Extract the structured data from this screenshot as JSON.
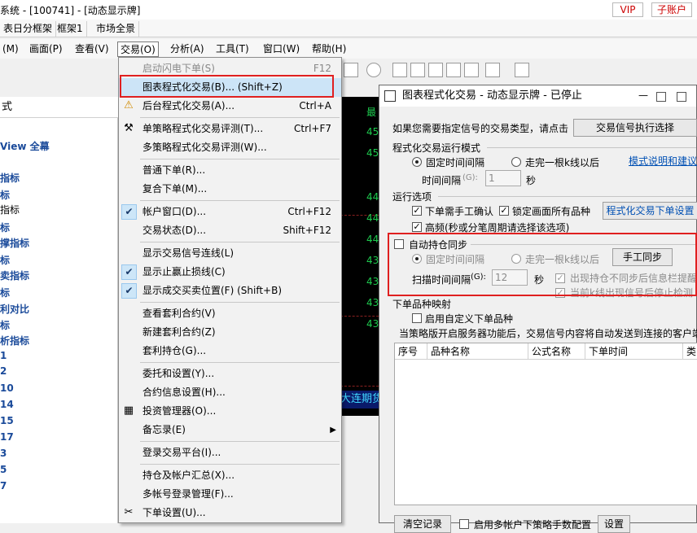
{
  "titlebar": {
    "title": "系统 - [100741] - [动态显示牌]",
    "vip": "VIP",
    "sub_account": "子账户"
  },
  "tabs": [
    "表日分框架",
    "框架1",
    "市场全景"
  ],
  "menubar": [
    "(M)",
    "画面(P)",
    "查看(V)",
    "交易(O)",
    "分析(A)",
    "工具(T)",
    "窗口(W)",
    "帮助(H)"
  ],
  "left_panel": {
    "header": "式",
    "items": [
      {
        "label": "View 全幕",
        "style": "bold"
      },
      {
        "label": "指标",
        "style": "bold"
      },
      {
        "label": "标",
        "style": "bold"
      },
      {
        "label": "指标",
        "style": "plain"
      },
      {
        "label": "标",
        "style": "bold"
      },
      {
        "label": "撑指标",
        "style": "bold"
      },
      {
        "label": "标",
        "style": "bold"
      },
      {
        "label": "卖指标",
        "style": "bold"
      },
      {
        "label": "标",
        "style": "bold"
      },
      {
        "label": "利对比",
        "style": "bold"
      },
      {
        "label": "标",
        "style": "bold"
      },
      {
        "label": "析指标",
        "style": "bold"
      },
      {
        "label": "1",
        "style": "bold"
      },
      {
        "label": "2",
        "style": "bold"
      },
      {
        "label": "10",
        "style": "bold"
      },
      {
        "label": "14",
        "style": "bold"
      },
      {
        "label": "15",
        "style": "bold"
      },
      {
        "label": "17",
        "style": "bold"
      },
      {
        "label": "3",
        "style": "bold"
      },
      {
        "label": "5",
        "style": "bold"
      },
      {
        "label": "7",
        "style": "bold"
      }
    ]
  },
  "chart": {
    "top_label": "最",
    "prices": [
      "45",
      "45",
      "44",
      "44",
      "44",
      "43",
      "43",
      "43",
      "43"
    ],
    "footer": "大连期货"
  },
  "trade_menu": {
    "items": [
      {
        "label": "启动闪电下单(S)",
        "shortcut": "F12",
        "state": "disabled",
        "icon": ""
      },
      {
        "label": "图表程式化交易(B)...  (Shift+Z)",
        "shortcut": "",
        "state": "highlight",
        "icon": ""
      },
      {
        "label": "后台程式化交易(A)...",
        "shortcut": "Ctrl+A",
        "state": "normal",
        "icon": "warning"
      },
      {
        "sep": true
      },
      {
        "label": "单策略程式化交易评测(T)...",
        "shortcut": "Ctrl+F7",
        "state": "normal",
        "icon": "hammer"
      },
      {
        "label": "多策略程式化交易评测(W)...",
        "shortcut": "",
        "state": "normal",
        "icon": ""
      },
      {
        "sep": true
      },
      {
        "label": "普通下单(R)...",
        "shortcut": "",
        "state": "normal",
        "icon": ""
      },
      {
        "label": "复合下单(M)...",
        "shortcut": "",
        "state": "normal",
        "icon": ""
      },
      {
        "sep": true
      },
      {
        "label": "帐户窗口(D)...",
        "shortcut": "Ctrl+F12",
        "state": "checked",
        "icon": ""
      },
      {
        "label": "交易状态(D)...",
        "shortcut": "Shift+F12",
        "state": "normal",
        "icon": ""
      },
      {
        "sep": true
      },
      {
        "label": "显示交易信号连线(L)",
        "shortcut": "",
        "state": "normal",
        "icon": ""
      },
      {
        "label": "显示止赢止损线(C)",
        "shortcut": "",
        "state": "checked",
        "icon": ""
      },
      {
        "label": "显示成交买卖位置(F)  (Shift+B)",
        "shortcut": "",
        "state": "checked",
        "icon": ""
      },
      {
        "sep": true
      },
      {
        "label": "查看套利合约(V)",
        "shortcut": "",
        "state": "normal",
        "icon": ""
      },
      {
        "label": "新建套利合约(Z)",
        "shortcut": "",
        "state": "normal",
        "icon": ""
      },
      {
        "label": "套利持仓(G)...",
        "shortcut": "",
        "state": "normal",
        "icon": ""
      },
      {
        "sep": true
      },
      {
        "label": "委托和设置(Y)...",
        "shortcut": "",
        "state": "normal",
        "icon": ""
      },
      {
        "label": "合约信息设置(H)...",
        "shortcut": "",
        "state": "normal",
        "icon": ""
      },
      {
        "label": "投资管理器(O)...",
        "shortcut": "",
        "state": "normal",
        "icon": "grid"
      },
      {
        "label": "备忘录(E)",
        "shortcut": "",
        "state": "submenu",
        "icon": ""
      },
      {
        "sep": true
      },
      {
        "label": "登录交易平台(I)...",
        "shortcut": "",
        "state": "normal",
        "icon": ""
      },
      {
        "sep": true
      },
      {
        "label": "持仓及帐户汇总(X)...",
        "shortcut": "",
        "state": "normal",
        "icon": ""
      },
      {
        "label": "多帐号登录管理(F)...",
        "shortcut": "",
        "state": "normal",
        "icon": ""
      },
      {
        "label": "下单设置(U)...",
        "shortcut": "",
        "state": "normal",
        "icon": "tools"
      }
    ]
  },
  "dialog": {
    "title": "图表程式化交易 - 动态显示牌 - 已停止",
    "intro": "如果您需要指定信号的交易类型，请点击",
    "signal_btn": "交易信号执行选择",
    "mode_group": "程式化交易运行模式",
    "radio_fixed": "固定时间间隔",
    "radio_bar": "走完一根k线以后",
    "mode_link": "模式说明和建议",
    "interval_label": "时间间隔",
    "interval_hint": "(G):",
    "interval_value": "1",
    "interval_unit": "秒",
    "options_group": "运行选项",
    "opt_manual": "下单需手工确认",
    "opt_lock": "锁定画面所有品种",
    "opt_settings_btn": "程式化交易下单设置",
    "opt_high": "高频(秒或分笔周期请选择该选项)",
    "sync_label": "自动持仓同步",
    "sync_fixed": "固定时间间隔",
    "sync_bar": "走完一根k线以后",
    "sync_btn": "手工同步",
    "scan_label": "扫描时间间隔",
    "scan_hint": "(G):",
    "scan_value": "12",
    "scan_unit": "秒",
    "sync_opt1": "出现持仓不同步后信息栏提醒",
    "sync_opt2": "当前k线出现信号后停止检测",
    "mapping_group": "下单品种映射",
    "mapping_cb": "启用自定义下单品种",
    "server_note": "当策略版开启服务器功能后，交易信号内容将自动发送到连接的客户端",
    "columns": [
      "序号",
      "品种名称",
      "公式名称",
      "下单时间",
      "类"
    ],
    "bottom_btn1": "清空记录",
    "bottom_cb": "启用多帐户下策略手数配置",
    "bottom_btn2": "设置"
  },
  "colors": {
    "highlight": "#cce4f7",
    "red_box": "#e02020",
    "chart_green": "#1ecc4f",
    "link": "#0050b4"
  }
}
